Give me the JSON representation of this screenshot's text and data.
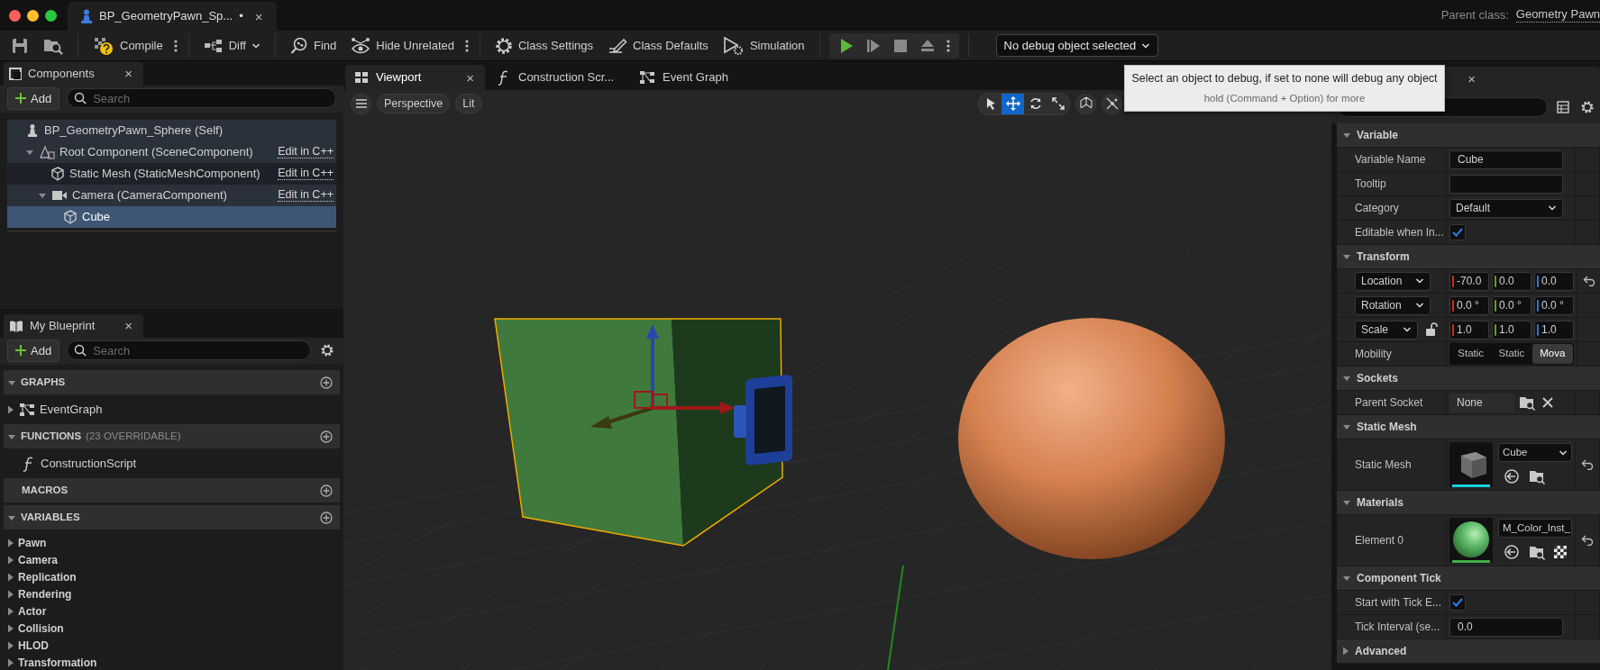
{
  "window": {
    "tab_title": "BP_GeometryPawn_Sp...",
    "unsaved_mark": "•",
    "tab_close": "×",
    "parent_class_label": "Parent class:",
    "parent_class": "Geometry Pawn"
  },
  "toolbar": {
    "items": [
      {
        "kind": "compile",
        "label": "Compile",
        "more": true
      },
      {
        "kind": "diff",
        "label": "Diff",
        "caret": true
      },
      {
        "kind": "find",
        "label": "Find"
      },
      {
        "kind": "hide",
        "label": "Hide Unrelated",
        "more": true
      },
      {
        "kind": "settings",
        "label": "Class Settings"
      },
      {
        "kind": "defaults",
        "label": "Class Defaults"
      },
      {
        "kind": "simulation",
        "label": "Simulation"
      }
    ],
    "debug_object": "No debug object selected"
  },
  "tooltip": {
    "text": "Select an object to debug, if set to none will debug any object",
    "hint": "hold (Command + Option) for more"
  },
  "components": {
    "title": "Components",
    "close": "×",
    "add": "Add",
    "search": {
      "placeholder": "Search"
    },
    "root": {
      "label": "BP_GeometryPawn_Sphere (Self)",
      "kind": "actor",
      "selected": false,
      "children": [
        {
          "label": "Root Component (SceneComponent)",
          "kind": "scene",
          "link": "Edit in C++",
          "selected": false,
          "expanded": true,
          "children": [
            {
              "label": "Static Mesh (StaticMeshComponent)",
              "kind": "mesh",
              "link": "Edit in C++",
              "selected": false
            },
            {
              "label": "Camera (CameraComponent)",
              "kind": "camera",
              "link": "Edit in C++",
              "selected": false,
              "expanded": true,
              "children": [
                {
                  "label": "Cube",
                  "kind": "mesh",
                  "selected": true
                }
              ]
            }
          ]
        }
      ]
    }
  },
  "my_blueprint": {
    "title": "My Blueprint",
    "close": "×",
    "add": "Add",
    "search": {
      "placeholder": "Search"
    },
    "sections": [
      {
        "title": "GRAPHS",
        "expanded": true,
        "items": [
          {
            "label": "EventGraph",
            "kind": "graph",
            "expanded": false
          }
        ]
      },
      {
        "title": "FUNCTIONS",
        "note": "(23 OVERRIDABLE)",
        "expanded": true,
        "items": [
          {
            "label": "ConstructionScript",
            "kind": "function"
          }
        ]
      },
      {
        "title": "MACROS"
      },
      {
        "title": "VARIABLES",
        "expanded": true,
        "items": [
          {
            "label": "Pawn",
            "kind": "category",
            "expanded": false
          },
          {
            "label": "Camera",
            "kind": "category",
            "expanded": false
          },
          {
            "label": "Replication",
            "kind": "category",
            "expanded": false
          },
          {
            "label": "Rendering",
            "kind": "category",
            "expanded": false
          },
          {
            "label": "Actor",
            "kind": "category",
            "expanded": false
          },
          {
            "label": "Collision",
            "kind": "category",
            "expanded": false
          },
          {
            "label": "HLOD",
            "kind": "category",
            "expanded": false
          },
          {
            "label": "Transformation",
            "kind": "category",
            "expanded": false
          }
        ]
      }
    ]
  },
  "editor_tabs": {
    "close": "×",
    "tabs": [
      {
        "label": "Viewport",
        "kind": "viewport",
        "selected": true
      },
      {
        "label": "Construction Scr...",
        "kind": "function",
        "selected": false
      },
      {
        "label": "Event Graph",
        "kind": "graph",
        "selected": false
      }
    ]
  },
  "viewport": {
    "view_mode": "Perspective",
    "lighting": "Lit",
    "tools": [
      {
        "kind": "select",
        "selected": false
      },
      {
        "kind": "move",
        "selected": true
      },
      {
        "kind": "rotate",
        "selected": false
      },
      {
        "kind": "scale",
        "selected": false
      }
    ]
  },
  "details": {
    "close": "×",
    "sections": [
      {
        "title": "Variable",
        "expanded": true,
        "rows": [
          {
            "kind": "text",
            "label": "Variable Name",
            "value": "Cube"
          },
          {
            "kind": "text",
            "label": "Tooltip"
          },
          {
            "kind": "combo",
            "label": "Category",
            "value": "Default"
          },
          {
            "kind": "checkbox",
            "label": "Editable when In...",
            "checked": true
          }
        ]
      },
      {
        "title": "Transform",
        "expanded": true,
        "rows": [
          {
            "kind": "vector",
            "label": "Location",
            "values": [
              "-70.0",
              "0.0",
              "0.0"
            ],
            "reset": true
          },
          {
            "kind": "vector",
            "label": "Rotation",
            "values": [
              "0.0 °",
              "0.0 °",
              "0.0 °"
            ]
          },
          {
            "kind": "vector",
            "label": "Scale",
            "values": [
              "1.0",
              "1.0",
              "1.0"
            ],
            "locked": false
          },
          {
            "kind": "segmented",
            "label": "Mobility",
            "options": [
              {
                "label": "Static",
                "selected": false
              },
              {
                "label": "Static",
                "selected": false
              },
              {
                "label": "Mova",
                "selected": true
              }
            ]
          }
        ]
      },
      {
        "title": "Sockets",
        "expanded": true,
        "rows": [
          {
            "kind": "socket",
            "label": "Parent Socket",
            "value": "None"
          }
        ]
      },
      {
        "title": "Static Mesh",
        "expanded": true,
        "rows": [
          {
            "kind": "asset",
            "label": "Static Mesh",
            "value": "Cube",
            "thumbnail": {
              "kind": "cube"
            },
            "menu": true,
            "reset": true
          }
        ]
      },
      {
        "title": "Materials",
        "expanded": true,
        "rows": [
          {
            "kind": "asset",
            "label": "Element 0",
            "value": "M_Color_Inst_",
            "thumbnail": {
              "kind": "sphere"
            },
            "reset": true
          }
        ]
      },
      {
        "title": "Component Tick",
        "expanded": true,
        "rows": [
          {
            "kind": "checkbox",
            "label": "Start with Tick E...",
            "checked": true
          },
          {
            "kind": "text",
            "label": "Tick Interval (se...",
            "value": "0.0"
          }
        ]
      },
      {
        "title": "Advanced",
        "expanded": false
      }
    ]
  }
}
